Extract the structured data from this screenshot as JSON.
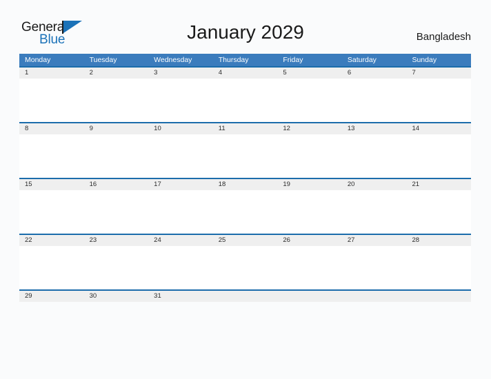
{
  "brand": {
    "name_part1": "General",
    "name_part2": "Blue",
    "flag_icon": "flag-triangle-icon",
    "color_primary": "#1b72b8",
    "color_text": "#1a1a1a"
  },
  "header": {
    "title": "January 2029",
    "country": "Bangladesh"
  },
  "calendar": {
    "month": "January",
    "year": "2029",
    "week_start": "Monday",
    "header_color": "#3b7cbd",
    "rule_color": "#1b6cab",
    "date_band_color": "#efefef",
    "weekdays": [
      "Monday",
      "Tuesday",
      "Wednesday",
      "Thursday",
      "Friday",
      "Saturday",
      "Sunday"
    ],
    "weeks": [
      {
        "dates": [
          "1",
          "2",
          "3",
          "4",
          "5",
          "6",
          "7"
        ]
      },
      {
        "dates": [
          "8",
          "9",
          "10",
          "11",
          "12",
          "13",
          "14"
        ]
      },
      {
        "dates": [
          "15",
          "16",
          "17",
          "18",
          "19",
          "20",
          "21"
        ]
      },
      {
        "dates": [
          "22",
          "23",
          "24",
          "25",
          "26",
          "27",
          "28"
        ]
      },
      {
        "dates": [
          "29",
          "30",
          "31",
          "",
          "",
          "",
          ""
        ]
      }
    ]
  }
}
